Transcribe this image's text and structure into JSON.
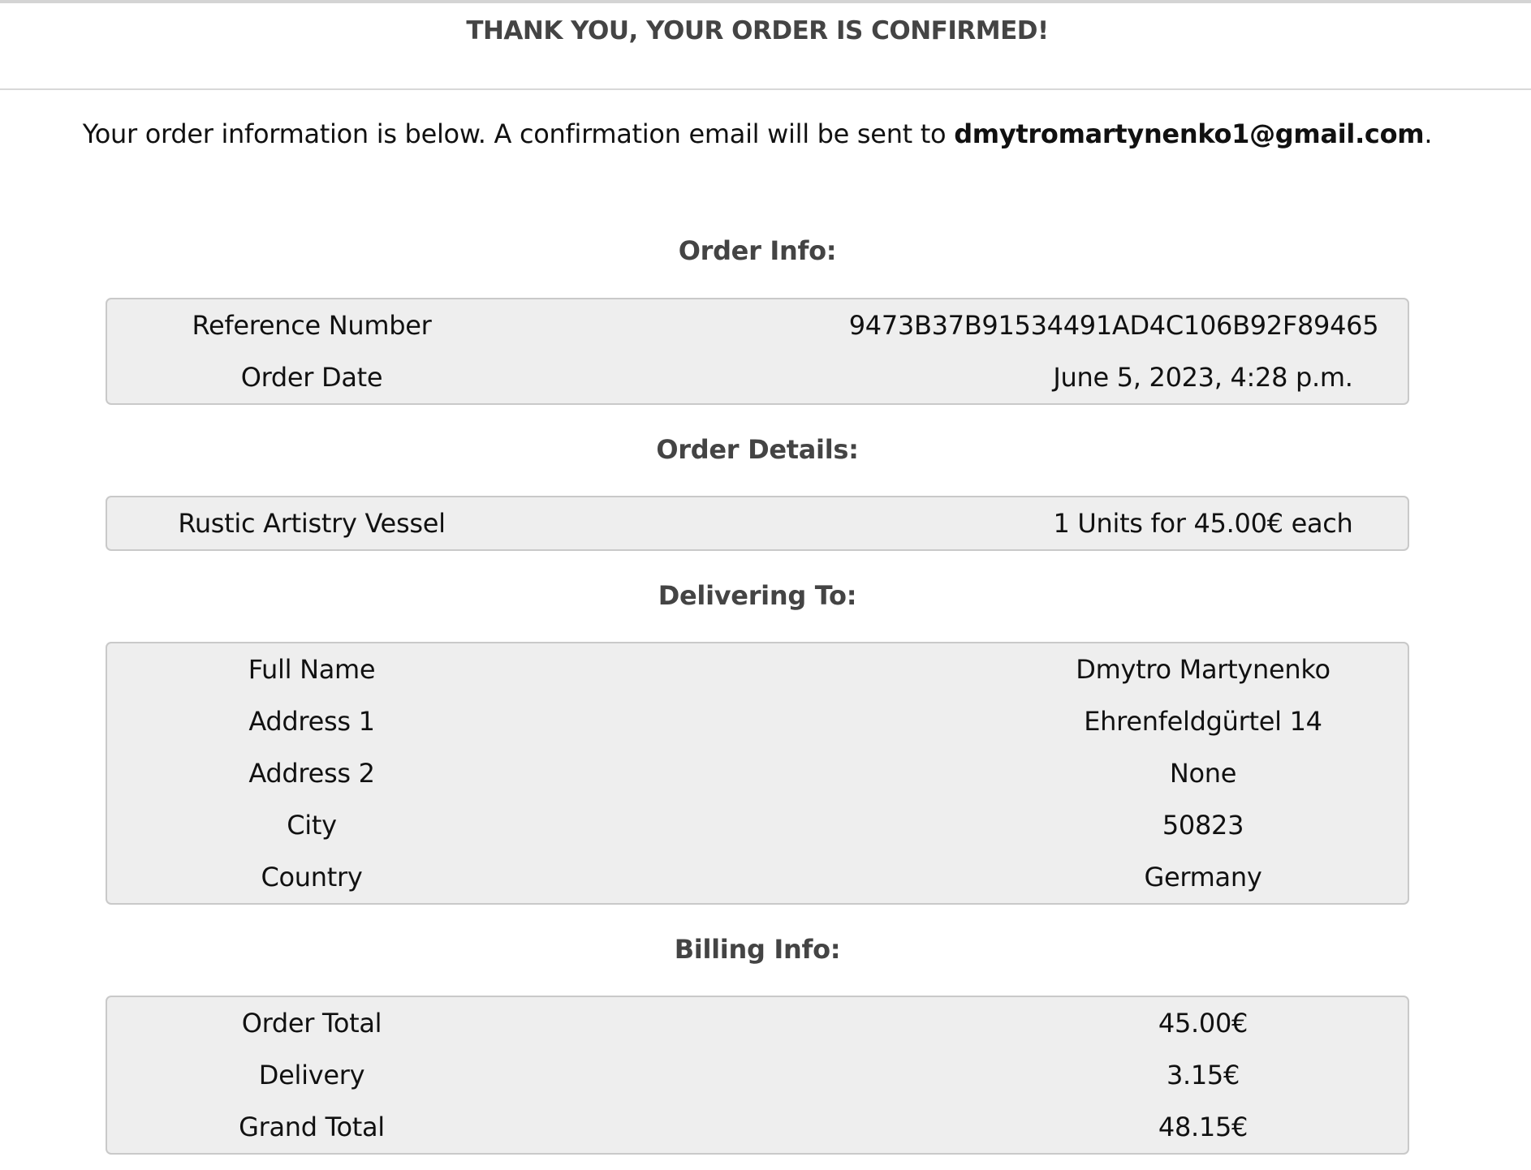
{
  "header": {
    "title": "THANK YOU, YOUR ORDER IS CONFIRMED!"
  },
  "intro": {
    "text_before": "Your order information is below. A confirmation email will be sent to ",
    "email": "dmytromartynenko1@gmail.com",
    "text_after": "."
  },
  "order_info": {
    "title": "Order Info:",
    "rows": [
      {
        "label": "Reference Number",
        "value": "9473B37B91534491AD4C106B92F89465"
      },
      {
        "label": "Order Date",
        "value": "June 5, 2023, 4:28 p.m."
      }
    ]
  },
  "order_details": {
    "title": "Order Details:",
    "rows": [
      {
        "label": "Rustic Artistry Vessel",
        "value": "1 Units for 45.00€ each"
      }
    ]
  },
  "delivering_to": {
    "title": "Delivering To:",
    "rows": [
      {
        "label": "Full Name",
        "value": "Dmytro Martynenko"
      },
      {
        "label": "Address 1",
        "value": "Ehrenfeldgürtel 14"
      },
      {
        "label": "Address 2",
        "value": "None"
      },
      {
        "label": "City",
        "value": "50823"
      },
      {
        "label": "Country",
        "value": "Germany"
      }
    ]
  },
  "billing_info": {
    "title": "Billing Info:",
    "rows": [
      {
        "label": "Order Total",
        "value": "45.00€"
      },
      {
        "label": "Delivery",
        "value": "3.15€"
      },
      {
        "label": "Grand Total",
        "value": "48.15€"
      }
    ]
  }
}
